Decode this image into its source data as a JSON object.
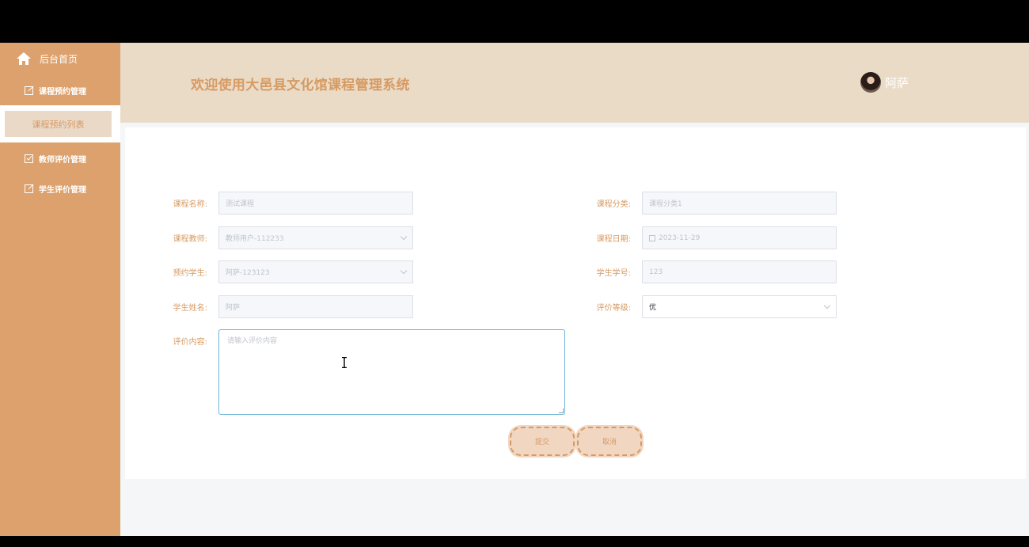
{
  "sidebar": {
    "home": "后台首页",
    "menus": [
      "课程预约管理",
      "教师评价管理",
      "学生评价管理"
    ],
    "active_sub": "课程预约列表"
  },
  "header": {
    "title": "欢迎使用大邑县文化馆课程管理系统",
    "username": "阿萨"
  },
  "form": {
    "course_name": {
      "label": "课程名称:",
      "value": "测试课程"
    },
    "course_category": {
      "label": "课程分类:",
      "value": "课程分类1"
    },
    "teacher": {
      "label": "课程教师:",
      "value": "教师用户-112233"
    },
    "course_date": {
      "label": "课程日期:",
      "value": "2023-11-29"
    },
    "student": {
      "label": "预约学生:",
      "value": "阿萨-123123"
    },
    "student_id": {
      "label": "学生学号:",
      "value": "123"
    },
    "student_name": {
      "label": "学生姓名:",
      "value": "阿萨"
    },
    "rating": {
      "label": "评价等级:",
      "value": "优"
    },
    "comment": {
      "label": "评价内容:",
      "placeholder": "请输入评价内容"
    },
    "submit": "提交",
    "cancel": "取消"
  },
  "colors": {
    "sidebar_bg": "#dca16c",
    "header_bg": "#eadbc7",
    "accent": "#d79a63"
  }
}
